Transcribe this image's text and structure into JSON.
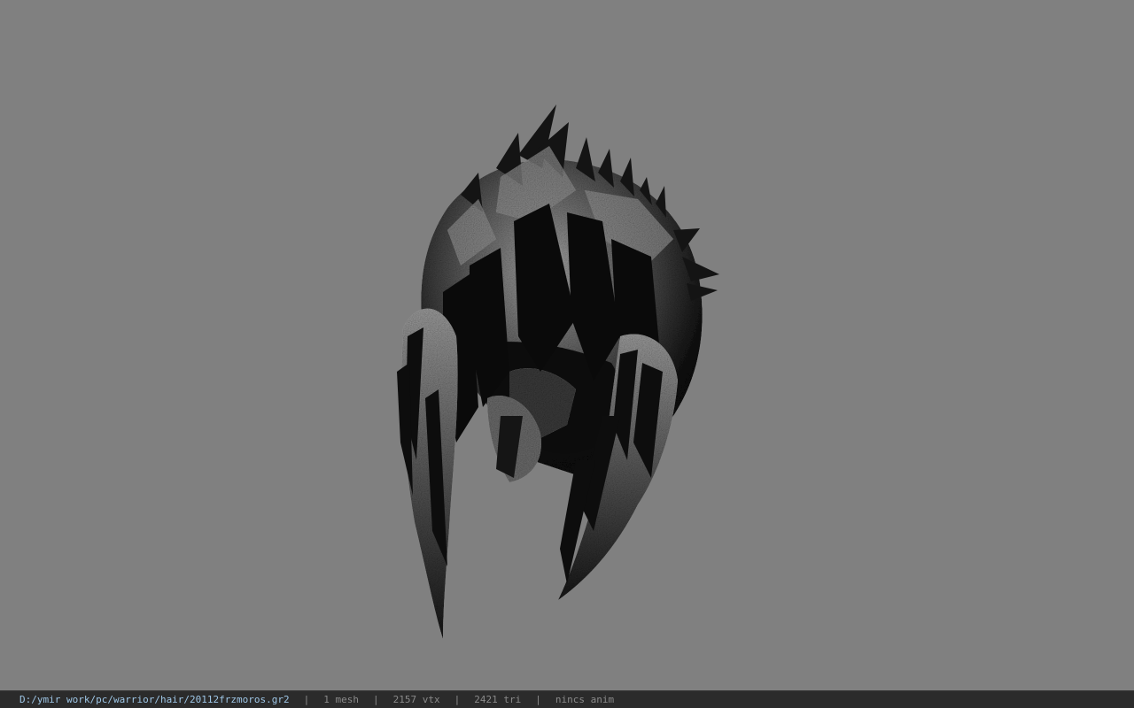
{
  "viewport": {
    "background_color": "#808080",
    "model_icon": "hair-mesh-icon"
  },
  "statusbar": {
    "path": "D:/ymir work/pc/warrior/hair/20112frzmoros.gr2",
    "mesh_count": "1 mesh",
    "vertex_count": "2157 vtx",
    "triangle_count": "2421 tri",
    "anim_status": "nincs anim",
    "separator": "|",
    "path_color": "#9ec6e6",
    "background_color": "#2b2b2b"
  }
}
